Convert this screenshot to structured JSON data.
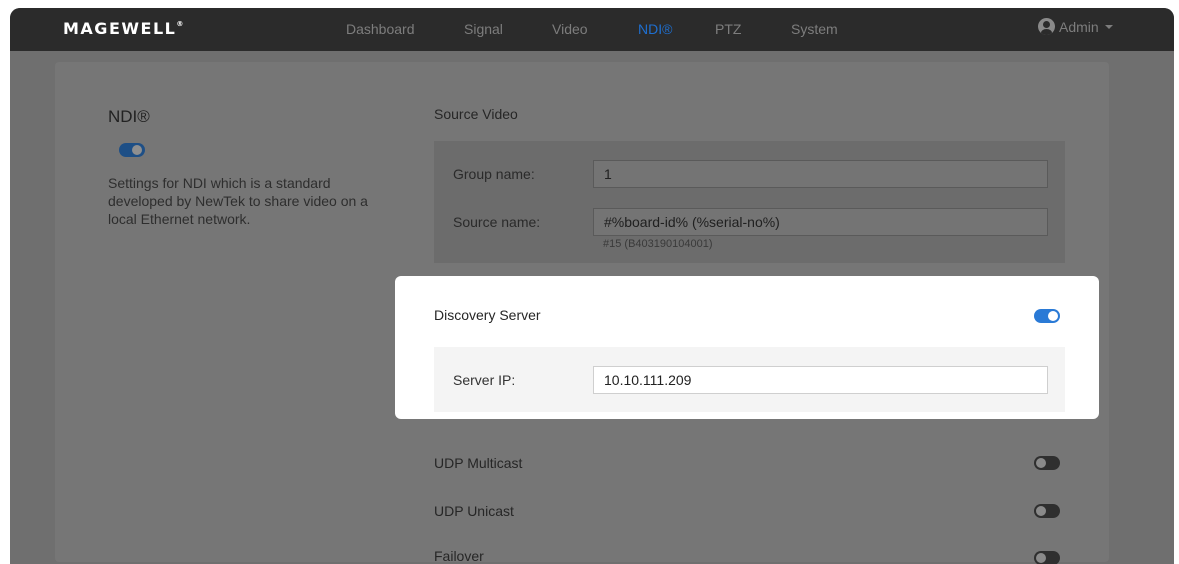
{
  "header": {
    "logo": "MAGEWELL",
    "logo_mark": "®",
    "nav": [
      {
        "label": "Dashboard",
        "active": false
      },
      {
        "label": "Signal",
        "active": false
      },
      {
        "label": "Video",
        "active": false
      },
      {
        "label": "NDI®",
        "active": true
      },
      {
        "label": "PTZ",
        "active": false
      },
      {
        "label": "System",
        "active": false
      }
    ],
    "user": {
      "label": "Admin",
      "icon": "user-avatar-icon"
    }
  },
  "sidebar": {
    "title": "NDI®",
    "enabled": true,
    "description": "Settings for NDI which is a standard developed by NewTek to share video on a local Ethernet network."
  },
  "source_video": {
    "title": "Source Video",
    "group_name_label": "Group name:",
    "group_name_value": "1",
    "source_name_label": "Source name:",
    "source_name_value": "#%board-id% (%serial-no%)",
    "source_name_hint": "#15 (B403190104001)"
  },
  "discovery_server": {
    "title": "Discovery Server",
    "enabled": true,
    "server_ip_label": "Server IP:",
    "server_ip_value": "10.10.111.209"
  },
  "udp_multicast": {
    "title": "UDP Multicast",
    "enabled": false
  },
  "udp_unicast": {
    "title": "UDP Unicast",
    "enabled": false
  },
  "failover": {
    "title": "Failover",
    "enabled": false
  },
  "colors": {
    "accent": "#2a7ad6",
    "nav_active": "#1e6fd0",
    "topbar": "#2b2b2b",
    "overlay": "#6f6f6f"
  }
}
